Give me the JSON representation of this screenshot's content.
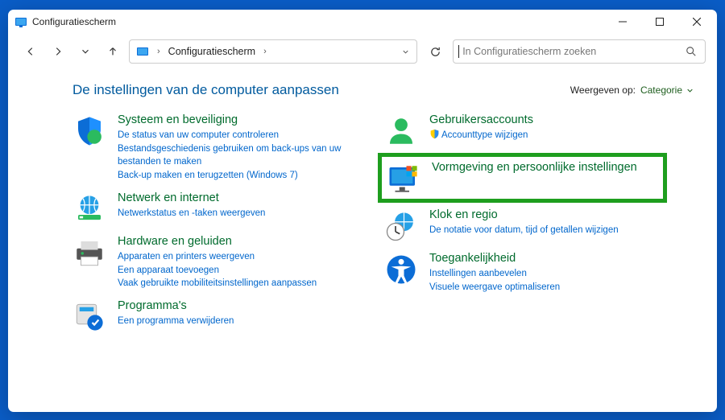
{
  "window": {
    "title": "Configuratiescherm"
  },
  "breadcrumb": {
    "root": "Configuratiescherm"
  },
  "search": {
    "placeholder": "In Configuratiescherm zoeken"
  },
  "page": {
    "heading": "De instellingen van de computer aanpassen",
    "viewby_label": "Weergeven op:",
    "viewby_value": "Categorie"
  },
  "cats": {
    "system": {
      "name": "Systeem en beveiliging",
      "links": [
        "De status van uw computer controleren",
        "Bestandsgeschiedenis gebruiken om back-ups van uw bestanden te maken",
        "Back-up maken en terugzetten (Windows 7)"
      ]
    },
    "network": {
      "name": "Netwerk en internet",
      "links": [
        "Netwerkstatus en -taken weergeven"
      ]
    },
    "hardware": {
      "name": "Hardware en geluiden",
      "links": [
        "Apparaten en printers weergeven",
        "Een apparaat toevoegen",
        "Vaak gebruikte mobiliteitsinstellingen aanpassen"
      ]
    },
    "programs": {
      "name": "Programma's",
      "links": [
        "Een programma verwijderen"
      ]
    },
    "users": {
      "name": "Gebruikersaccounts",
      "links": [
        "Accounttype wijzigen"
      ]
    },
    "appearance": {
      "name": "Vormgeving en persoonlijke instellingen",
      "links": []
    },
    "clock": {
      "name": "Klok en regio",
      "links": [
        "De notatie voor datum, tijd of getallen wijzigen"
      ]
    },
    "access": {
      "name": "Toegankelijkheid",
      "links": [
        "Instellingen aanbevelen",
        "Visuele weergave optimaliseren"
      ]
    }
  }
}
